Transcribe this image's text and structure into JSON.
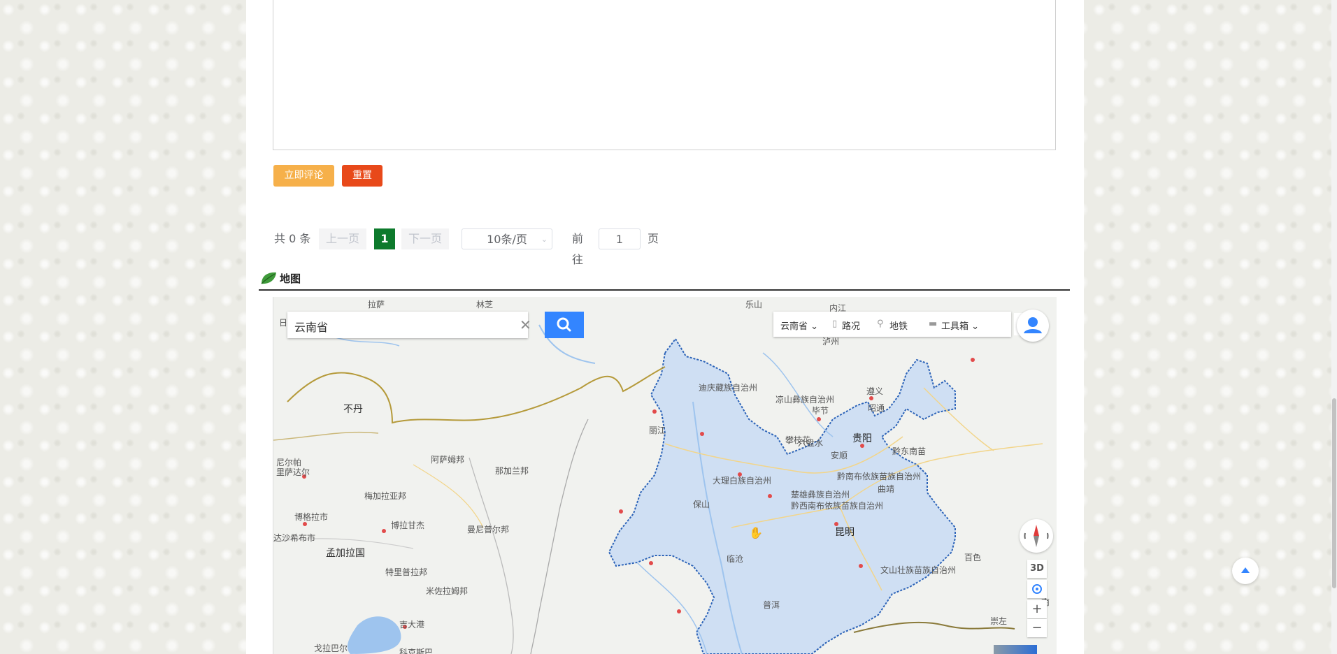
{
  "comment_form": {
    "submit_label": "立即评论",
    "reset_label": "重置"
  },
  "pagination": {
    "total_text": "共 0 条",
    "prev_label": "上一页",
    "current_page": "1",
    "next_label": "下一页",
    "page_size": "10条/页",
    "goto_label": "前往",
    "goto_value": "1",
    "page_suffix": "页"
  },
  "section": {
    "title": "地图",
    "icon": "leaf-icon"
  },
  "map": {
    "search_value": "云南省",
    "toolbar": {
      "region": "云南省",
      "traffic": "路况",
      "subway": "地铁",
      "tools": "工具箱"
    },
    "controls": {
      "three_d": "3D",
      "zoom_in": "+",
      "zoom_out": "−"
    },
    "labels": {
      "lasa": "拉萨",
      "linzhi": "林芝",
      "ri": "日",
      "neijiang": "内江",
      "leshan": "乐山",
      "luzhou": "泸州",
      "zunyi": "遵义",
      "bijie": "毕节",
      "guiyang": "贵阳",
      "liupanshui": "六盘水",
      "anshun": "安顺",
      "qiandongnan": "黔东南苗",
      "qiannan": "黔南布依族苗族自治州",
      "qianxinan": "黔西南布依族苗族自治州",
      "diqing": "迪庆藏族自治州",
      "liangshan": "凉山彝族自治州",
      "zhaotong": "昭通",
      "lijiang": "丽江",
      "panzhihua": "攀枝花",
      "dali": "大理白族自治州",
      "chuxiong": "楚雄彝族自治州",
      "qujing": "曲靖",
      "baoshan": "保山",
      "kunming": "昆明",
      "lincang": "临沧",
      "wenshan": "文山壮族苗族自治州",
      "baise": "百色",
      "puer": "普洱",
      "bhutan": "不丹",
      "assam": "阿萨姆邦",
      "nagaland": "那加兰邦",
      "nepal_a": "尼尔帕",
      "nepal_b": "里萨达尔",
      "meghalaya": "梅加拉亚邦",
      "manipur": "曼尼普尔邦",
      "biratnagar": "博格拉市",
      "bogra": "博拉甘杰",
      "dhaka": "达沙希布市",
      "bangladesh": "孟加拉国",
      "tripura": "特里普拉邦",
      "mizoram": "米佐拉姆邦",
      "jidagang": "吉大港",
      "kalapur": "戈拉巴尔",
      "kyaukpyu": "科克斯巴",
      "chongzuo": "崇左",
      "nan": "南"
    }
  }
}
